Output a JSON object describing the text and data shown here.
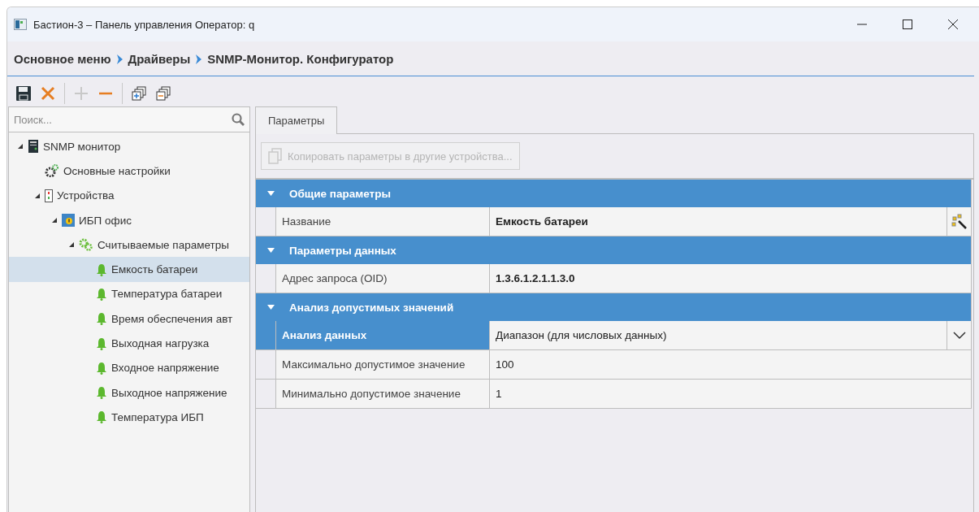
{
  "window": {
    "title": "Бастион-3 – Панель управления Оператор: q"
  },
  "breadcrumb": [
    {
      "label": "Основное меню"
    },
    {
      "label": "Драйверы"
    },
    {
      "label": "SNMP-Монитор. Конфигуратор"
    }
  ],
  "toolbar": [
    {
      "kind": "save"
    },
    {
      "kind": "delete"
    },
    {
      "kind": "separator"
    },
    {
      "kind": "add",
      "disabled": true
    },
    {
      "kind": "remove",
      "disabled": false
    },
    {
      "kind": "separator"
    },
    {
      "kind": "expand"
    },
    {
      "kind": "collapse"
    }
  ],
  "search": {
    "placeholder": "Поиск..."
  },
  "tree": [
    {
      "label": "SNMP монитор",
      "kind": "server",
      "expanded": true,
      "selected": false,
      "children": [
        {
          "label": "Основные настройки",
          "kind": "settings",
          "selected": false
        },
        {
          "label": "Устройства",
          "kind": "devices",
          "expanded": true,
          "selected": false,
          "children": [
            {
              "label": "ИБП офис",
              "kind": "ups",
              "expanded": true,
              "selected": false,
              "children": [
                {
                  "label": "Считываемые параметры",
                  "kind": "params",
                  "expanded": true,
                  "selected": false,
                  "children": [
                    {
                      "label": "Емкость батареи",
                      "kind": "bell",
                      "selected": true
                    },
                    {
                      "label": "Температура батареи",
                      "kind": "bell",
                      "selected": false
                    },
                    {
                      "label": "Время обеспечения авт",
                      "kind": "bell",
                      "selected": false
                    },
                    {
                      "label": "Выходная нагрузка",
                      "kind": "bell",
                      "selected": false
                    },
                    {
                      "label": "Входное напряжение",
                      "kind": "bell",
                      "selected": false
                    },
                    {
                      "label": "Выходное напряжение",
                      "kind": "bell",
                      "selected": false
                    },
                    {
                      "label": "Температура ИБП",
                      "kind": "bell",
                      "selected": false
                    }
                  ]
                }
              ]
            }
          ]
        }
      ]
    }
  ],
  "tabs": [
    {
      "label": "Параметры",
      "selected": true
    }
  ],
  "copy_button": {
    "label": "Копировать параметры в другие устройства...",
    "disabled": true
  },
  "sections": [
    {
      "title": "Общие параметры",
      "expanded": true,
      "rows": [
        {
          "label": "Название",
          "value": "Емкость батареи",
          "bold": true,
          "kind": "picker",
          "selected": false
        }
      ]
    },
    {
      "title": "Параметры данных",
      "expanded": true,
      "rows": [
        {
          "label": "Адрес запроса (OID)",
          "value": "1.3.6.1.2.1.1.3.0",
          "bold": true,
          "kind": "text",
          "selected": false
        }
      ]
    },
    {
      "title": "Анализ допустимых значений",
      "expanded": true,
      "rows": [
        {
          "label": "Анализ данных",
          "value": "Диапазон (для числовых данных)",
          "bold": false,
          "kind": "dropdown",
          "selected": true
        },
        {
          "label": "Максимально допустимое значение",
          "value": "100",
          "bold": false,
          "kind": "text",
          "selected": false
        },
        {
          "label": "Минимально допустимое значение",
          "value": "1",
          "bold": false,
          "kind": "text",
          "selected": false
        }
      ]
    }
  ]
}
